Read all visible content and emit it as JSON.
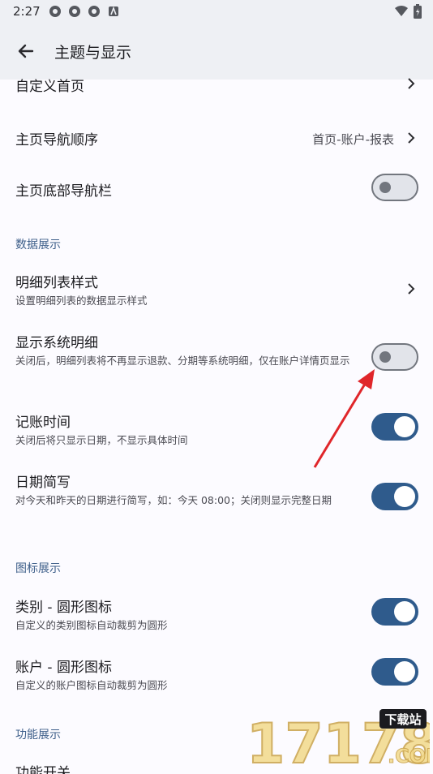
{
  "status": {
    "time": "2:27"
  },
  "header": {
    "title": "主题与显示"
  },
  "rows": {
    "custom_home": {
      "title": "自定义首页"
    },
    "nav_order": {
      "title": "主页导航顺序",
      "value": "首页-账户-报表"
    },
    "bottom_nav": {
      "title": "主页底部导航栏",
      "enabled": false
    }
  },
  "sections": {
    "data": "数据展示",
    "icons": "图标展示",
    "features": "功能展示"
  },
  "data_rows": {
    "list_style": {
      "title": "明细列表样式",
      "subtitle": "设置明细列表的数据显示样式"
    },
    "system_detail": {
      "title": "显示系统明细",
      "subtitle": "关闭后，明细列表将不再显示退款、分期等系统明细，仅在账户详情页显示",
      "enabled": false
    },
    "record_time": {
      "title": "记账时间",
      "subtitle": "关闭后将只显示日期，不显示具体时间",
      "enabled": true
    },
    "date_short": {
      "title": "日期简写",
      "subtitle": "对今天和昨天的日期进行简写，如：今天 08:00；关闭则显示完整日期",
      "enabled": true
    }
  },
  "icon_rows": {
    "category": {
      "title": "类别 - 圆形图标",
      "subtitle": "自定义的类别图标自动裁剪为圆形",
      "enabled": true
    },
    "account": {
      "title": "账户 - 圆形图标",
      "subtitle": "自定义的账户图标自动裁剪为圆形",
      "enabled": true
    }
  },
  "feature_rows": {
    "switch": {
      "title": "功能开关"
    }
  },
  "watermark": {
    "number": "17178",
    "tag": "下载站",
    "domain": ".COM"
  },
  "colors": {
    "accent": "#2f5b8c",
    "section": "#3e5f8a",
    "arrow": "#e0262a"
  }
}
